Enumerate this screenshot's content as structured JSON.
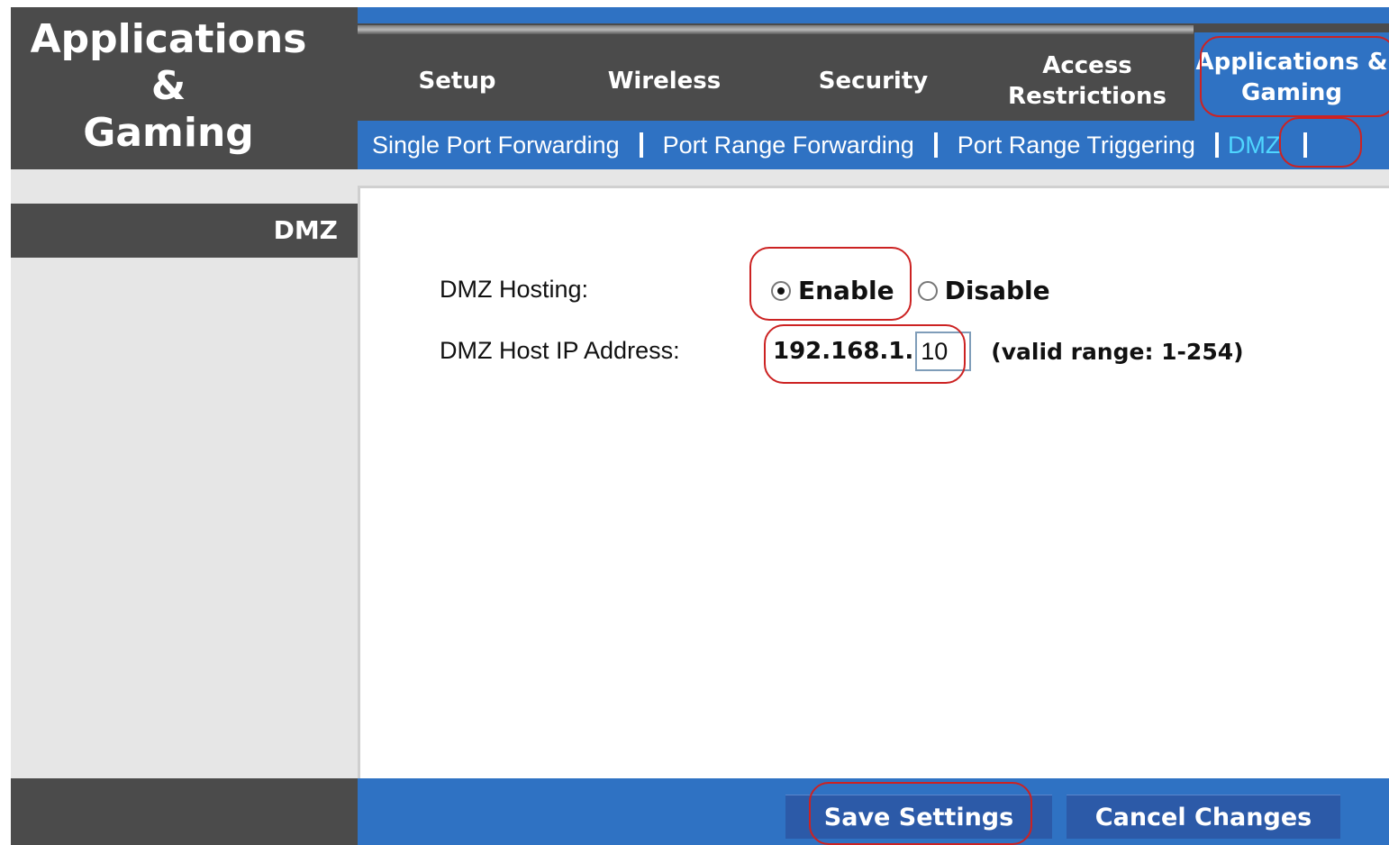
{
  "header": {
    "title_line1": "Applications &",
    "title_line2": "Gaming"
  },
  "tabs": [
    {
      "label": "Setup"
    },
    {
      "label": "Wireless"
    },
    {
      "label": "Security"
    },
    {
      "label_line1": "Access",
      "label_line2": "Restrictions"
    },
    {
      "label_line1": "Applications &",
      "label_line2": "Gaming",
      "active": true
    }
  ],
  "subnav": {
    "items": [
      "Single Port Forwarding",
      "Port Range Forwarding",
      "Port Range Triggering",
      "DMZ"
    ],
    "active": "DMZ"
  },
  "section": {
    "label": "DMZ"
  },
  "form": {
    "hosting_label": "DMZ Hosting:",
    "enable_label": "Enable",
    "disable_label": "Disable",
    "hosting_value": "Enable",
    "host_ip_label": "DMZ Host IP Address:",
    "ip_prefix": "192.168.1.",
    "ip_last_octet": "10",
    "ip_hint": "(valid range: 1-254)"
  },
  "footer": {
    "save_label": "Save Settings",
    "cancel_label": "Cancel Changes"
  },
  "colors": {
    "accent_blue": "#2f72c3",
    "dark_gray": "#4b4b4b",
    "active_subnav": "#4fd6ff",
    "highlight_red": "#cc2222"
  }
}
